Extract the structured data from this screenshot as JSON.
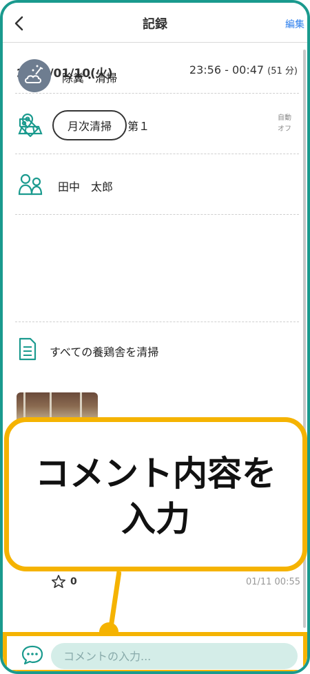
{
  "header": {
    "title": "記録",
    "edit_label": "編集"
  },
  "record": {
    "date": "2023/01/10(火)",
    "time_range": "23:56 - 00:47",
    "duration": "(51 分)",
    "farm_name": "田中養鶏農作 第１",
    "auto_line1": "自動",
    "auto_line2": "オフ",
    "person": "田中　太郎",
    "task": "除糞・清掃",
    "tag": "月次清掃",
    "memo": "すべての養鶏舎を清掃"
  },
  "callout": {
    "line1": "コメント内容を",
    "line2": "入力"
  },
  "comment_meta": {
    "star_count": "0",
    "timestamp": "01/11 00:55"
  },
  "comment_input": {
    "placeholder": "コメントの入力..."
  },
  "colors": {
    "frame": "#1a9a8e",
    "accent": "#f5b301",
    "icon_teal": "#1a9a8e",
    "link": "#2f80ed",
    "input_bg": "#d4ede8"
  },
  "icons": [
    "back-arrow-icon",
    "map-pin-icon",
    "people-icon",
    "cleaning-icon",
    "tag-icon",
    "document-icon",
    "star-icon",
    "comment-bubble-icon"
  ]
}
